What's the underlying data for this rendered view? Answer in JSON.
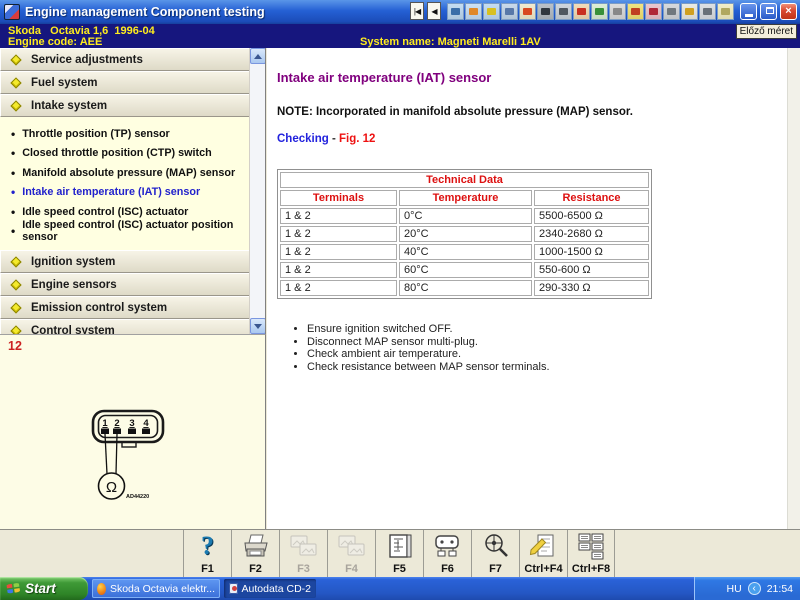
{
  "window": {
    "title": "Engine management Component testing",
    "nav": {
      "first": "|◀",
      "back": "◀"
    },
    "toolbar_icons": [
      {
        "name": "tools",
        "bg": "#bcd8f0",
        "fg": "#3a6ea8"
      },
      {
        "name": "gauge",
        "bg": "#c4dcf2",
        "fg": "#e08828"
      },
      {
        "name": "car-service",
        "bg": "#bcd8f0",
        "fg": "#d8c020"
      },
      {
        "name": "technicians",
        "bg": "#c0d4e8",
        "fg": "#5878a8"
      },
      {
        "name": "parts",
        "bg": "#f0e8c8",
        "fg": "#d84820"
      },
      {
        "name": "engine",
        "bg": "#b0b8c0",
        "fg": "#303840"
      },
      {
        "name": "diagnostic-tool",
        "bg": "#c8d0d8",
        "fg": "#505860"
      },
      {
        "name": "components",
        "bg": "#f0d8b0",
        "fg": "#c83020"
      },
      {
        "name": "vehicle-lift",
        "bg": "#d8ecd0",
        "fg": "#389038"
      },
      {
        "name": "handshake",
        "bg": "#d8d8d8",
        "fg": "#888888"
      },
      {
        "name": "help-info",
        "bg": "#f0e070",
        "fg": "#c04020"
      },
      {
        "name": "wiring-figure",
        "bg": "#e8c0c8",
        "fg": "#b02838"
      },
      {
        "name": "disc",
        "bg": "#d0d4d8",
        "fg": "#70787e"
      },
      {
        "name": "warning",
        "bg": "#e8e8e0",
        "fg": "#d0a020"
      },
      {
        "name": "vehicle",
        "bg": "#d8dce0",
        "fg": "#687078"
      },
      {
        "name": "card",
        "bg": "#f0ecc0",
        "fg": "#b0a860"
      }
    ],
    "controls": {
      "minimize": "minimize",
      "restore": "restore",
      "close": "×"
    },
    "tooltip": "Előző méret"
  },
  "header": {
    "vehicle": "Skoda   Octavia 1,6  1996-04",
    "engine_code": "Engine code: AEE",
    "system_name": "System name: Magneti Marelli 1AV"
  },
  "sidebar": {
    "sections": [
      {
        "label": "Service adjustments",
        "expanded": false
      },
      {
        "label": "Fuel system",
        "expanded": false
      },
      {
        "label": "Intake system",
        "expanded": true,
        "items": [
          {
            "label": "Throttle position (TP) sensor",
            "selected": false
          },
          {
            "label": "Closed throttle position (CTP) switch",
            "selected": false
          },
          {
            "label": "Manifold absolute pressure (MAP) sensor",
            "selected": false
          },
          {
            "label": "Intake air temperature (IAT) sensor",
            "selected": true
          },
          {
            "label": "Idle speed control (ISC) actuator",
            "selected": false
          },
          {
            "label": "Idle speed control (ISC) actuator position sensor",
            "selected": false
          }
        ]
      },
      {
        "label": "Ignition system",
        "expanded": false
      },
      {
        "label": "Engine sensors",
        "expanded": false
      },
      {
        "label": "Emission control system",
        "expanded": false
      },
      {
        "label": "Control system",
        "expanded": false
      }
    ]
  },
  "figure": {
    "number": "12",
    "pins": [
      "1",
      "2",
      "3",
      "4"
    ],
    "symbol": "Ω",
    "code": "AD44220"
  },
  "content": {
    "title": "Intake air temperature (IAT) sensor",
    "note": "NOTE: Incorporated in manifold absolute pressure (MAP) sensor.",
    "checking_label": "Checking",
    "checking_separator": " - ",
    "fig_ref": "Fig. 12",
    "table": {
      "title": "Technical Data",
      "columns": [
        "Terminals",
        "Temperature",
        "Resistance"
      ],
      "rows": [
        [
          "1 & 2",
          "0°C",
          "5500-6500 Ω"
        ],
        [
          "1 & 2",
          "20°C",
          "2340-2680 Ω"
        ],
        [
          "1 & 2",
          "40°C",
          "1000-1500 Ω"
        ],
        [
          "1 & 2",
          "60°C",
          "550-600 Ω"
        ],
        [
          "1 & 2",
          "80°C",
          "290-330 Ω"
        ]
      ]
    },
    "bullets": [
      "Ensure ignition switched OFF.",
      "Disconnect MAP sensor multi-plug.",
      "Check ambient air temperature.",
      "Check resistance between MAP sensor terminals."
    ]
  },
  "fkeys": [
    {
      "label": "F1",
      "icon": "help",
      "enabled": true
    },
    {
      "label": "F2",
      "icon": "print",
      "enabled": true
    },
    {
      "label": "F3",
      "icon": "images",
      "enabled": false
    },
    {
      "label": "F4",
      "icon": "images",
      "enabled": false
    },
    {
      "label": "F5",
      "icon": "wiring",
      "enabled": true
    },
    {
      "label": "F6",
      "icon": "connector",
      "enabled": true
    },
    {
      "label": "F7",
      "icon": "locate",
      "enabled": true
    },
    {
      "label": "Ctrl+F4",
      "icon": "notes",
      "enabled": true
    },
    {
      "label": "Ctrl+F8",
      "icon": "data-list",
      "enabled": true
    }
  ],
  "taskbar": {
    "start_label": "Start",
    "tasks": [
      {
        "label": "Skoda Octavia elektr...",
        "icon": "firefox",
        "active": false
      },
      {
        "label": "Autodata CD-2",
        "icon": "autodata",
        "active": true
      }
    ],
    "tray": {
      "lang": "HU",
      "clock": "21:54"
    }
  },
  "colors": {
    "title_purple": "#80007e",
    "table_red": "#dd1111",
    "link_blue": "#2222dd",
    "fig_red": "#ee1111",
    "selected_item_blue": "#2222cc",
    "header_navy": "#16167e",
    "header_yellow": "#ffec1e",
    "panel_cream": "#ffffe1"
  }
}
